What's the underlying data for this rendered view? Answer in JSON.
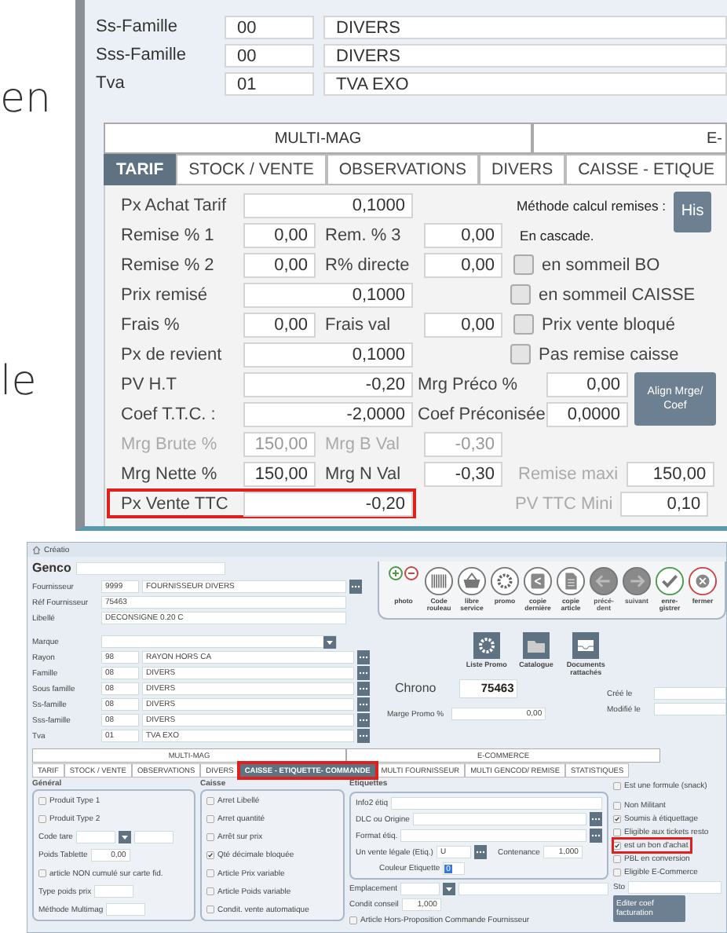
{
  "intro_fragments": [
    "en",
    "le"
  ],
  "detail_window": {
    "family_rows": [
      {
        "label": "Ss-Famille",
        "code": "00",
        "name": "DIVERS"
      },
      {
        "label": "Sss-Famille",
        "code": "00",
        "name": "DIVERS"
      },
      {
        "label": "Tva",
        "code": "01",
        "name": "TVA EXO"
      }
    ],
    "section_tabs": [
      "MULTI-MAG",
      "E-"
    ],
    "tabs": [
      {
        "label": "TARIF",
        "selected": true
      },
      {
        "label": "STOCK / VENTE",
        "selected": false
      },
      {
        "label": "OBSERVATIONS",
        "selected": false
      },
      {
        "label": "DIVERS",
        "selected": false
      },
      {
        "label": "CAISSE - ETIQUE",
        "selected": false
      }
    ],
    "price_rows": [
      {
        "kind": "wide",
        "label": "Px Achat Tarif",
        "value": "0,1000",
        "disabled": false,
        "highlighted": false,
        "side": {
          "kind": "note",
          "text": "Méthode calcul remises :",
          "button": "His"
        }
      },
      {
        "kind": "pair",
        "label": "Remise % 1",
        "value": "0,00",
        "label2": "Rem. % 3",
        "value2": "0,00",
        "disabled": false,
        "highlighted": false,
        "side": {
          "kind": "note",
          "text": "En cascade."
        }
      },
      {
        "kind": "pair",
        "label": "Remise % 2",
        "value": "0,00",
        "label2": "R% directe",
        "value2": "0,00",
        "disabled": false,
        "highlighted": false,
        "side": {
          "kind": "checkbox",
          "text": "en sommeil BO",
          "checked": false
        }
      },
      {
        "kind": "wide",
        "label": "Prix remisé",
        "value": "0,1000",
        "disabled": false,
        "highlighted": false,
        "side": {
          "kind": "checkbox",
          "text": "en sommeil CAISSE",
          "checked": false
        }
      },
      {
        "kind": "pair",
        "label": "Frais %",
        "value": "0,00",
        "label2": "Frais val",
        "value2": "0,00",
        "disabled": false,
        "highlighted": false,
        "side": {
          "kind": "checkbox",
          "text": "Prix vente bloqué",
          "checked": false
        }
      },
      {
        "kind": "wide",
        "label": "Px de revient",
        "value": "0,1000",
        "disabled": false,
        "highlighted": false,
        "side": {
          "kind": "checkbox",
          "text": "Pas remise caisse",
          "checked": false
        }
      },
      {
        "kind": "preco",
        "disabled": false,
        "highlighted": false,
        "lines": [
          {
            "label": "PV H.T",
            "value": "-0,20",
            "label2": "Mrg Préco %",
            "value2": "0,00"
          },
          {
            "label": "Coef T.T.C. :",
            "value": "-2,0000",
            "label2": "Coef Préconisée",
            "value2": "0,0000"
          }
        ],
        "button": "Align Mrge/ Coef"
      },
      {
        "kind": "pair",
        "label": "Mrg Brute %",
        "value": "150,00",
        "label2": "Mrg B Val",
        "value2": "-0,30",
        "disabled": true,
        "highlighted": false
      },
      {
        "kind": "pair",
        "label": "Mrg Nette %",
        "value": "150,00",
        "label2": "Mrg N Val",
        "value2": "-0,30",
        "disabled": false,
        "highlighted": false,
        "side": {
          "kind": "limit",
          "text": "Remise maxi",
          "value": "150,00",
          "disabled": true
        }
      },
      {
        "kind": "wide",
        "label": "Px Vente TTC",
        "value": "-0,20",
        "disabled": false,
        "highlighted": true,
        "side": {
          "kind": "limit",
          "text": "PV TTC Mini",
          "value": "0,10",
          "disabled": true
        }
      }
    ]
  },
  "editor_window": {
    "title": "Créatio",
    "code_label": "Genco",
    "supplier_rows": [
      {
        "label": "Fournisseur",
        "code": "9999",
        "name": "FOURNISSEUR DIVERS"
      },
      {
        "label": "Réf Fournisseur",
        "name": "75463"
      },
      {
        "label": "Libellé",
        "name": "DECONSIGNE 0.20 C"
      }
    ],
    "toolbar": [
      {
        "kind": "photo",
        "label": "photo"
      },
      {
        "kind": "barcode",
        "label": "Code rouleau",
        "disabled": false
      },
      {
        "kind": "basket",
        "label": "libre service",
        "disabled": false
      },
      {
        "kind": "gear",
        "label": "promo",
        "disabled": false
      },
      {
        "kind": "share",
        "label": "copie dernière",
        "disabled": false
      },
      {
        "kind": "document",
        "label": "copie article",
        "disabled": false
      },
      {
        "kind": "left",
        "label": "précé-dent",
        "disabled": true
      },
      {
        "kind": "right",
        "label": "suivant",
        "disabled": true
      },
      {
        "kind": "check",
        "label": "enre-gistrer",
        "disabled": false
      },
      {
        "kind": "close",
        "label": "fermer",
        "disabled": false
      }
    ],
    "brand_label": "Marque",
    "category_rows": [
      {
        "label": "Rayon",
        "code": "98",
        "name": "RAYON HORS CA"
      },
      {
        "label": "Famille",
        "code": "08",
        "name": "DIVERS"
      },
      {
        "label": "Sous famille",
        "code": "08",
        "name": "DIVERS"
      },
      {
        "label": "Ss-famille",
        "code": "08",
        "name": "DIVERS"
      },
      {
        "label": "Sss-famille",
        "code": "08",
        "name": "DIVERS"
      },
      {
        "label": "Tva",
        "code": "01",
        "name": "TVA EXO"
      }
    ],
    "shortcuts": [
      {
        "kind": "gear",
        "label": "Liste Promo"
      },
      {
        "kind": "folder",
        "label": "Catalogue"
      },
      {
        "kind": "tray",
        "label": "Documents rattachés"
      }
    ],
    "chrono": {
      "label": "Chrono",
      "value": "75463"
    },
    "promo_margin": {
      "label": "Marge Promo %",
      "value": "0,00"
    },
    "dates": [
      "Créé le",
      "Modifié le"
    ],
    "section_tabs": [
      "MULTI-MAG",
      "E-COMMERCE"
    ],
    "tabs": [
      {
        "label": "TARIF",
        "selected": false,
        "highlighted": false
      },
      {
        "label": "STOCK / VENTE",
        "selected": false,
        "highlighted": false
      },
      {
        "label": "OBSERVATIONS",
        "selected": false,
        "highlighted": false
      },
      {
        "label": "DIVERS",
        "selected": false,
        "highlighted": false
      },
      {
        "label": "CAISSE - ETIQUETTE- COMMANDE",
        "selected": true,
        "highlighted": true
      },
      {
        "label": "MULTI FOURNISSEUR",
        "selected": false,
        "highlighted": false
      },
      {
        "label": "MULTI GENCOD/ REMISE",
        "selected": false,
        "highlighted": false
      },
      {
        "label": "STATISTIQUES",
        "selected": false,
        "highlighted": false
      }
    ],
    "general": {
      "title": "Général",
      "items": [
        {
          "kind": "checkbox",
          "label": "Produit Type 1",
          "checked": false
        },
        {
          "kind": "checkbox",
          "label": "Produit Type 2",
          "checked": false
        },
        {
          "kind": "dropdown",
          "label": "Code tare"
        },
        {
          "kind": "field",
          "label": "Poids Tablette",
          "value": "0,00"
        },
        {
          "kind": "checkbox",
          "label": "article NON cumulé sur carte fid.",
          "checked": false
        },
        {
          "kind": "field",
          "label": "Type poids prix",
          "value": ""
        },
        {
          "kind": "field",
          "label": "Méthode Multimag",
          "value": ""
        }
      ]
    },
    "till": {
      "title": "Caisse",
      "options": [
        {
          "label": "Arret Libellé",
          "checked": false
        },
        {
          "label": "Arret quantité",
          "checked": false
        },
        {
          "label": "Arrêt sur prix",
          "checked": false
        },
        {
          "label": "Qté décimale bloquée",
          "checked": true
        },
        {
          "label": "Article Prix variable",
          "checked": false
        },
        {
          "label": "Article Poids variable",
          "checked": false
        },
        {
          "label": "Condit. vente automatique",
          "checked": false
        }
      ]
    },
    "labels": {
      "title": "Etiquettes",
      "fields": [
        {
          "kind": "text",
          "label": "Info2 étiq"
        },
        {
          "kind": "lookup",
          "label": "DLC ou Origine"
        },
        {
          "kind": "lookup",
          "label": "Format étiq."
        },
        {
          "kind": "unit",
          "label": "Un vente légale (Etiq.)",
          "value": "U",
          "label2": "Contenance",
          "value2": "1,000"
        },
        {
          "kind": "color",
          "label": "Couleur Etiquette",
          "value": "0"
        }
      ]
    },
    "placement": {
      "label": "Emplacement",
      "advice_label": "Condit conseil",
      "advice_value": "1,000",
      "option": {
        "label": "Article Hors-Proposition Commande Fournisseur",
        "checked": false
      }
    },
    "formula": {
      "label": "Est une formule (snack)",
      "checked": false
    },
    "flags": [
      {
        "label": "Non Militant",
        "checked": false,
        "highlighted": false
      },
      {
        "label": "Soumis à étiquettage",
        "checked": true,
        "highlighted": false
      },
      {
        "label": "Eligible aux tickets resto",
        "checked": false,
        "highlighted": false
      },
      {
        "label": "est un bon d'achat",
        "checked": true,
        "highlighted": true
      },
      {
        "label": "PBL en conversion",
        "checked": false,
        "highlighted": false
      },
      {
        "label": "Eligible E-Commerce",
        "checked": false,
        "highlighted": false
      }
    ],
    "sto_label": "Sto",
    "coef_button": "Editer coef facturation"
  }
}
